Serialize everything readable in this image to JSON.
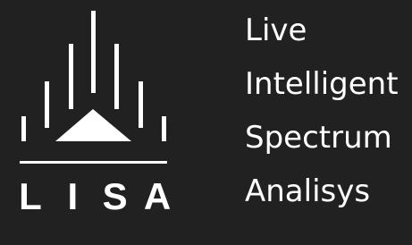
{
  "brand": {
    "letters": [
      "L",
      "I",
      "S",
      "A"
    ],
    "colors": {
      "background": "#212121",
      "foreground": "#ffffff"
    }
  },
  "tagline": {
    "lines": [
      "Live",
      "Intelligent",
      "Spectrum",
      "Analisys"
    ]
  }
}
